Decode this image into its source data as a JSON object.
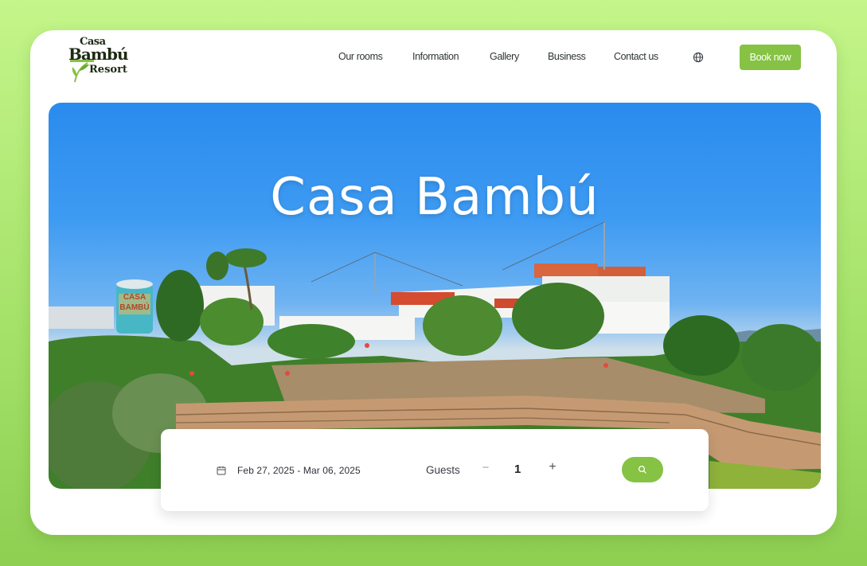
{
  "brand": {
    "logo_top": "Casa",
    "logo_main": "Bambú",
    "logo_bottom": "Resort"
  },
  "nav": {
    "items": [
      {
        "label": "Our rooms"
      },
      {
        "label": "Information"
      },
      {
        "label": "Gallery"
      },
      {
        "label": "Business"
      },
      {
        "label": "Contact us"
      }
    ],
    "language_icon": "globe-icon",
    "book_label": "Book now"
  },
  "hero": {
    "title": "Casa Bambú",
    "sign_text_1": "CASA",
    "sign_text_2": "BAMBÚ"
  },
  "search": {
    "date_icon": "calendar-icon",
    "dates": "Feb 27, 2025 - Mar 06, 2025",
    "guests_label": "Guests",
    "minus": "−",
    "guests_count": "1",
    "plus": "+",
    "search_icon": "search-icon"
  },
  "colors": {
    "accent": "#86c244",
    "background": "#b5ec7a",
    "sky": "#3e9bf2"
  }
}
